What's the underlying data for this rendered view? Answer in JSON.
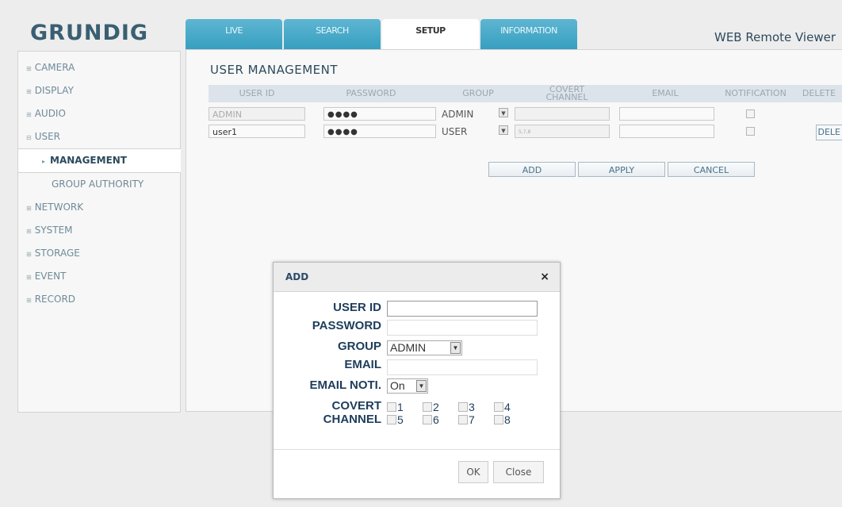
{
  "brand": {
    "logo": "GRUNDIG",
    "viewer_title": "WEB Remote Viewer"
  },
  "tabs": [
    "LIVE",
    "SEARCH",
    "SETUP",
    "INFORMATION"
  ],
  "sidebar": {
    "items": [
      {
        "label": "CAMERA"
      },
      {
        "label": "DISPLAY"
      },
      {
        "label": "AUDIO"
      },
      {
        "label": "USER"
      }
    ],
    "sub_items": [
      "MANAGEMENT",
      "GROUP AUTHORITY"
    ],
    "items_after": [
      {
        "label": "NETWORK"
      },
      {
        "label": "SYSTEM"
      },
      {
        "label": "STORAGE"
      },
      {
        "label": "EVENT"
      },
      {
        "label": "RECORD"
      }
    ]
  },
  "main": {
    "title": "USER MANAGEMENT",
    "headers": [
      "USER ID",
      "PASSWORD",
      "GROUP",
      "COVERT CHANNEL",
      "EMAIL",
      "NOTIFICATION",
      "DELETE"
    ],
    "rows": [
      {
        "user_id": "ADMIN",
        "password": "●●●●",
        "group": "ADMIN",
        "covert": "",
        "email": "",
        "delete": ""
      },
      {
        "user_id": "user1",
        "password": "●●●●",
        "group": "USER",
        "covert": "5,7,8",
        "email": "",
        "delete": "DELE"
      }
    ],
    "buttons": {
      "add": "ADD",
      "apply": "APPLY",
      "cancel": "CANCEL"
    }
  },
  "dialog": {
    "title": "ADD",
    "close_glyph": "×",
    "labels": {
      "user_id": "USER ID",
      "password": "PASSWORD",
      "group": "GROUP",
      "email": "EMAIL",
      "email_noti": "EMAIL NOTI.",
      "covert": "COVERT",
      "channel": "CHANNEL"
    },
    "group_value": "ADMIN",
    "email_noti_value": "On",
    "channels": [
      "1",
      "2",
      "3",
      "4",
      "5",
      "6",
      "7",
      "8"
    ],
    "ok": "OK",
    "close": "Close"
  }
}
